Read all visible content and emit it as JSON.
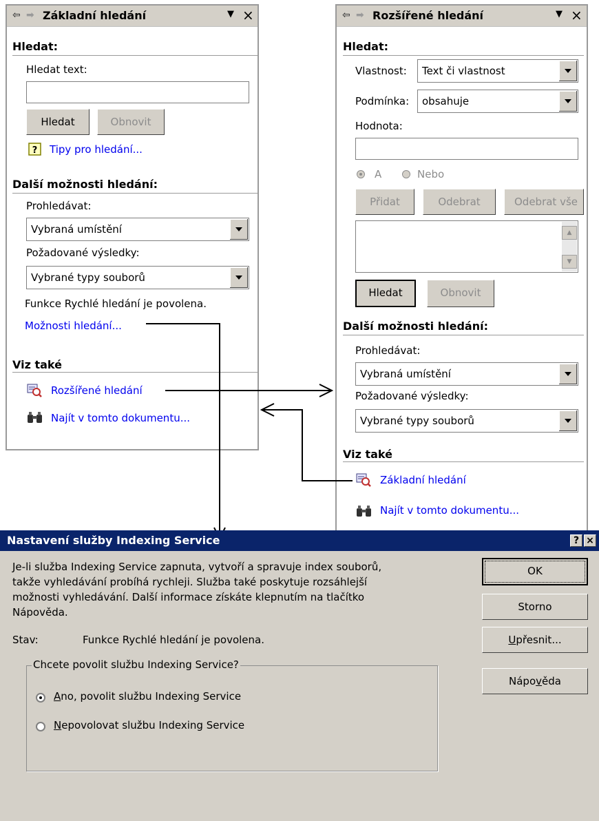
{
  "basic_pane": {
    "title": "Základní hledání",
    "search_header": "Hledat:",
    "search_text_label": "Hledat text:",
    "search_text_value": "",
    "search_button": "Hledat",
    "refresh_button": "Obnovit",
    "tips_link": "Tipy pro hledání...",
    "more_header": "Další možnosti hledání:",
    "search_in_label": "Prohledávat:",
    "search_in_value": "Vybraná umístění",
    "results_label": "Požadované výsledky:",
    "results_value": "Vybrané typy souborů",
    "fast_search_status": "Funkce Rychlé hledání je povolena.",
    "search_options_link": "Možnosti hledání...",
    "see_also_header": "Viz také",
    "advanced_link": "Rozšířené hledání",
    "find_in_doc_link": "Najít v tomto dokumentu..."
  },
  "advanced_pane": {
    "title": "Rozšířené hledání",
    "search_header": "Hledat:",
    "property_label": "Vlastnost:",
    "property_value": "Text či vlastnost",
    "condition_label": "Podmínka:",
    "condition_value": "obsahuje",
    "value_label": "Hodnota:",
    "value_value": "",
    "radio_and": "A",
    "radio_or": "Nebo",
    "add_button": "Přidat",
    "remove_button": "Odebrat",
    "remove_all_button": "Odebrat vše",
    "search_button": "Hledat",
    "refresh_button": "Obnovit",
    "more_header": "Další možnosti hledání:",
    "search_in_label": "Prohledávat:",
    "search_in_value": "Vybraná umístění",
    "results_label": "Požadované výsledky:",
    "results_value": "Vybrané typy souborů",
    "see_also_header": "Viz také",
    "basic_link": "Základní hledání",
    "find_in_doc_link": "Najít v tomto dokumentu..."
  },
  "dialog": {
    "title": "Nastavení služby Indexing Service",
    "help_btn": "?",
    "close_btn": "×",
    "desc_line1": "Je-li služba Indexing Service zapnuta, vytvoří a spravuje index souborů,",
    "desc_line2": "takže vyhledávání probíhá rychleji. Služba také poskytuje rozsáhlejší",
    "desc_line3": "možnosti vyhledávání. Další informace získáte klepnutím na tlačítko",
    "desc_line4": "Nápověda.",
    "status_label": "Stav:",
    "status_value": "Funkce Rychlé hledání je povolena.",
    "group_label": "Chcete povolit službu Indexing Service?",
    "option_yes_mn": "A",
    "option_yes_rest": "no, povolit službu Indexing Service",
    "option_no_mn": "N",
    "option_no_rest": "epovolovat službu Indexing Service",
    "ok_button": "OK",
    "cancel_button": "Storno",
    "advanced_mn": "U",
    "advanced_rest": "přesnit...",
    "help_pre": "Nápo",
    "help_mn": "v",
    "help_post": "ěda"
  },
  "colors": {
    "title_bar": "#0a246a",
    "link": "#0000ee",
    "face": "#d4d0c8"
  },
  "icons": [
    "pane-back-arrow-icon",
    "pane-forward-arrow-icon",
    "dropdown-arrow-icon",
    "close-icon",
    "help-tips-icon",
    "advanced-search-icon",
    "binoculars-icon"
  ]
}
